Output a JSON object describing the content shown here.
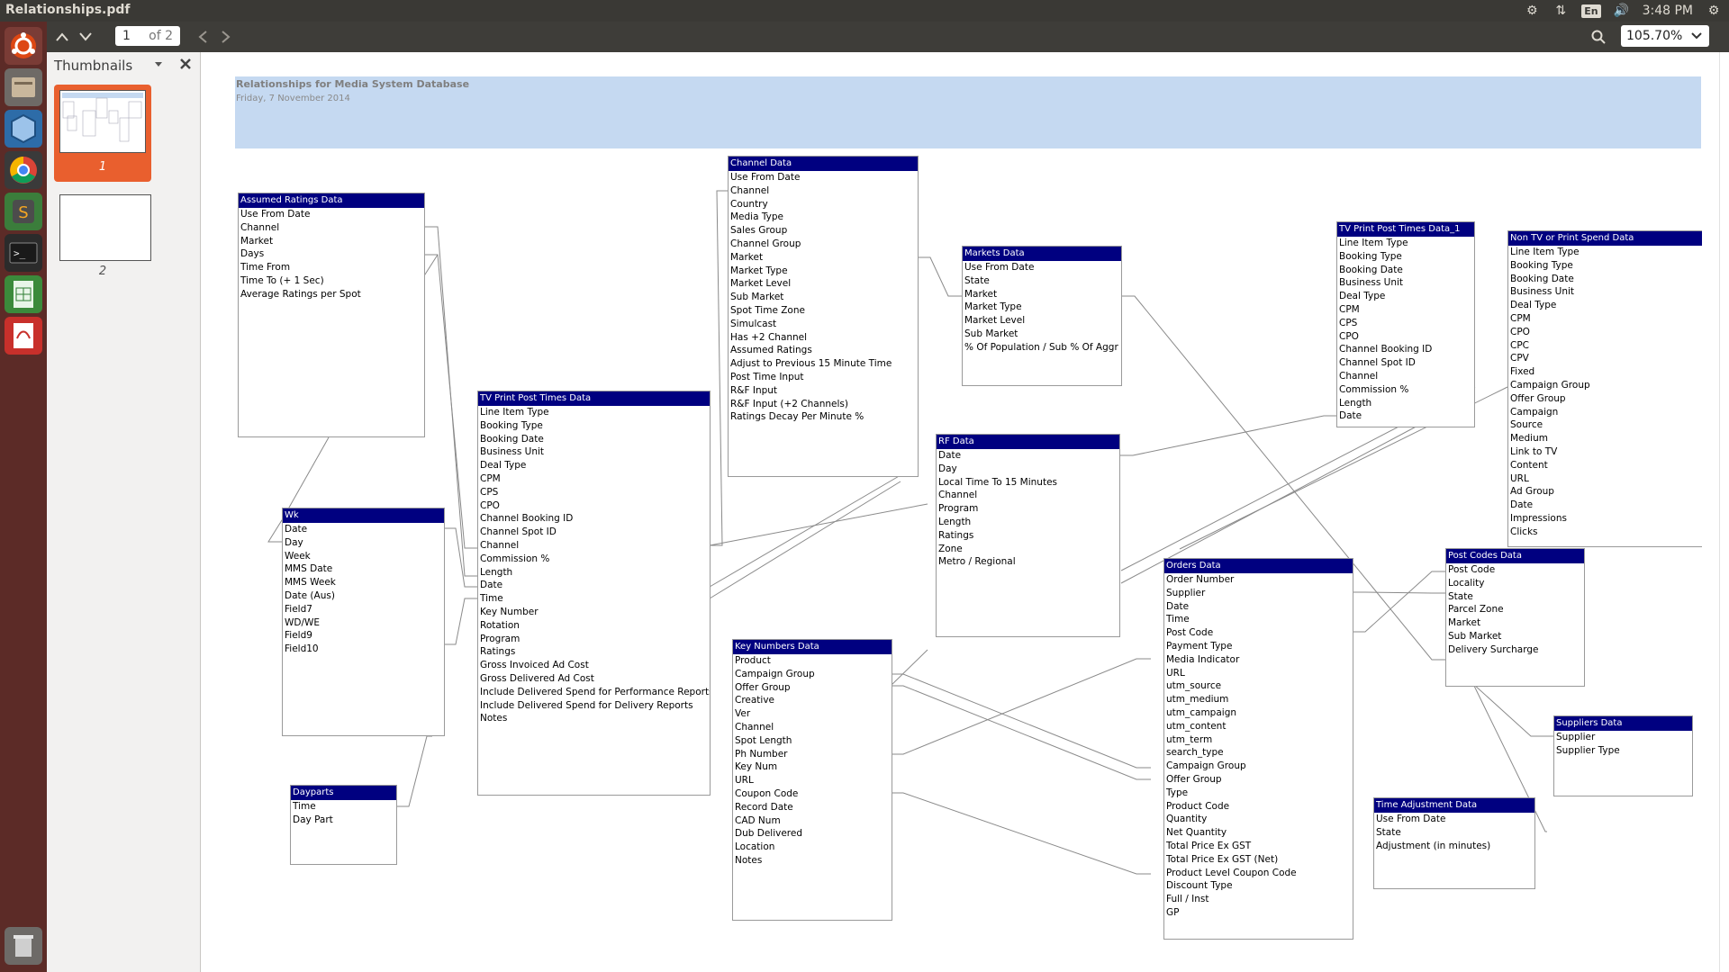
{
  "window": {
    "title": "Relationships.pdf"
  },
  "tray": {
    "language": "En",
    "time": "3:48 PM"
  },
  "toolbar": {
    "page_number": "1",
    "page_of": "of 2",
    "zoom": "105.70%"
  },
  "sidebar": {
    "title": "Thumbnails",
    "thumbnails": [
      {
        "label": "1"
      },
      {
        "label": "2"
      }
    ]
  },
  "report": {
    "title": "Relationships for Media System Database",
    "date": "Friday, 7 November 2014"
  },
  "tables": [
    {
      "name": "Assumed Ratings Data",
      "fields": [
        "Use From Date",
        "Channel",
        "Market",
        "Days",
        "Time From",
        "Time To (+ 1 Sec)",
        "Average Ratings per Spot"
      ]
    },
    {
      "name": "Wk",
      "fields": [
        "Date",
        "Day",
        "Week",
        "MMS Date",
        "MMS Week",
        "Date (Aus)",
        "Field7",
        "WD/WE",
        "Field9",
        "Field10"
      ]
    },
    {
      "name": "Dayparts",
      "fields": [
        "Time",
        "Day Part"
      ]
    },
    {
      "name": "TV  Print Post Times Data",
      "fields": [
        "Line Item Type",
        "Booking Type",
        "Booking Date",
        "Business Unit",
        "Deal Type",
        "CPM",
        "CPS",
        "CPO",
        "Channel Booking ID",
        "Channel Spot ID",
        "Channel",
        "Commission %",
        "Length",
        "Date",
        "Time",
        "Key Number",
        "Rotation",
        "Program",
        "Ratings",
        "Gross Invoiced Ad Cost",
        "Gross Delivered Ad Cost",
        "Include Delivered Spend for Performance Reports",
        "Include Delivered Spend for Delivery Reports",
        "Notes"
      ]
    },
    {
      "name": "Channel Data",
      "fields": [
        "Use From Date",
        "Channel",
        "Country",
        "Media Type",
        "Sales Group",
        "Channel Group",
        "Market",
        "Market Type",
        "Market Level",
        "Sub Market",
        "Spot Time Zone",
        "Simulcast",
        "Has +2 Channel",
        "Assumed Ratings",
        "Adjust to Previous 15 Minute Time",
        "Post Time Input",
        "R&F Input",
        "R&F Input (+2 Channels)",
        "Ratings Decay Per Minute %"
      ]
    },
    {
      "name": "Key Numbers Data",
      "fields": [
        "Product",
        "Campaign Group",
        "Offer Group",
        "Creative",
        "Ver",
        "Channel",
        "Spot Length",
        "Ph Number",
        "Key Num",
        "URL",
        "Coupon Code",
        "Record Date",
        "CAD Num",
        "Dub Delivered",
        "Location",
        "Notes"
      ]
    },
    {
      "name": "Markets Data",
      "fields": [
        "Use From Date",
        "State",
        "Market",
        "Market Type",
        "Market Level",
        "Sub Market",
        "% Of Population / Sub % Of Aggr"
      ]
    },
    {
      "name": "RF Data",
      "fields": [
        "Date",
        "Day",
        "Local Time To 15 Minutes",
        "Channel",
        "Program",
        "Length",
        "Ratings",
        "Zone",
        "Metro / Regional"
      ]
    },
    {
      "name": "Orders Data",
      "fields": [
        "Order Number",
        "Supplier",
        "Date",
        "Time",
        "Post Code",
        "Payment Type",
        "Media Indicator",
        "URL",
        "utm_source",
        "utm_medium",
        "utm_campaign",
        "utm_content",
        "utm_term",
        "search_type",
        "Campaign Group",
        "Offer Group",
        "Type",
        "Product Code",
        "Quantity",
        "Net Quantity",
        "Total Price Ex GST",
        "Total Price Ex GST (Net)",
        "Product Level Coupon Code",
        "Discount Type",
        "Full / Inst",
        "GP"
      ]
    },
    {
      "name": "TV  Print Post Times Data_1",
      "fields": [
        "Line Item Type",
        "Booking Type",
        "Booking Date",
        "Business Unit",
        "Deal Type",
        "CPM",
        "CPS",
        "CPO",
        "Channel Booking ID",
        "Channel Spot ID",
        "Channel",
        "Commission %",
        "Length",
        "Date"
      ]
    },
    {
      "name": "Non TV or Print Spend Data",
      "fields": [
        "Line Item Type",
        "Booking Type",
        "Booking Date",
        "Business Unit",
        "Deal Type",
        "CPM",
        "CPO",
        "CPC",
        "CPV",
        "Fixed",
        "Campaign Group",
        "Offer Group",
        "Campaign",
        "Source",
        "Medium",
        "Link to TV",
        "Content",
        "URL",
        "Ad Group",
        "Date",
        "Impressions",
        "Clicks"
      ]
    },
    {
      "name": "Post Codes Data",
      "fields": [
        "Post Code",
        "Locality",
        "State",
        "Parcel Zone",
        "Market",
        "Sub Market",
        "Delivery Surcharge"
      ]
    },
    {
      "name": "Suppliers Data",
      "fields": [
        "Supplier",
        "Supplier Type"
      ]
    },
    {
      "name": "Time Adjustment Data",
      "fields": [
        "Use From Date",
        "State",
        "Adjustment (in minutes)"
      ]
    }
  ]
}
